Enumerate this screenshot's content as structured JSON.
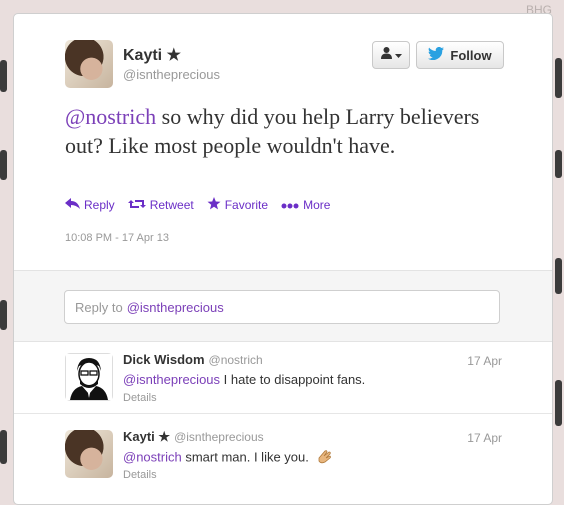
{
  "background_label": "BHG",
  "tweet": {
    "name": "Kayti ★",
    "handle": "@isntheprecious",
    "mention": "@nostrich",
    "text": " so why did you help Larry believers out? Like most people wouldn't have.",
    "timestamp": "10:08 PM - 17 Apr 13",
    "follow_label": "Follow"
  },
  "actions": [
    {
      "icon": "reply-icon",
      "label": "Reply"
    },
    {
      "icon": "retweet-icon",
      "label": "Retweet"
    },
    {
      "icon": "star-icon",
      "label": "Favorite"
    },
    {
      "icon": "more-dots-icon",
      "label": "More"
    }
  ],
  "reply_box": {
    "prefix": "Reply to",
    "mention": "@isntheprecious"
  },
  "replies": [
    {
      "name": "Dick Wisdom",
      "handle": "@nostrich",
      "date": "17 Apr",
      "mention": "@isntheprecious",
      "text": " I hate to disappoint fans.",
      "details": "Details"
    },
    {
      "name": "Kayti ★",
      "handle": "@isntheprecious",
      "date": "17 Apr",
      "mention": "@nostrich",
      "text": " smart man. I like you.",
      "details": "Details"
    }
  ],
  "colors": {
    "accent": "#7b3fb8",
    "twitter_bird": "#2aa1e1"
  }
}
